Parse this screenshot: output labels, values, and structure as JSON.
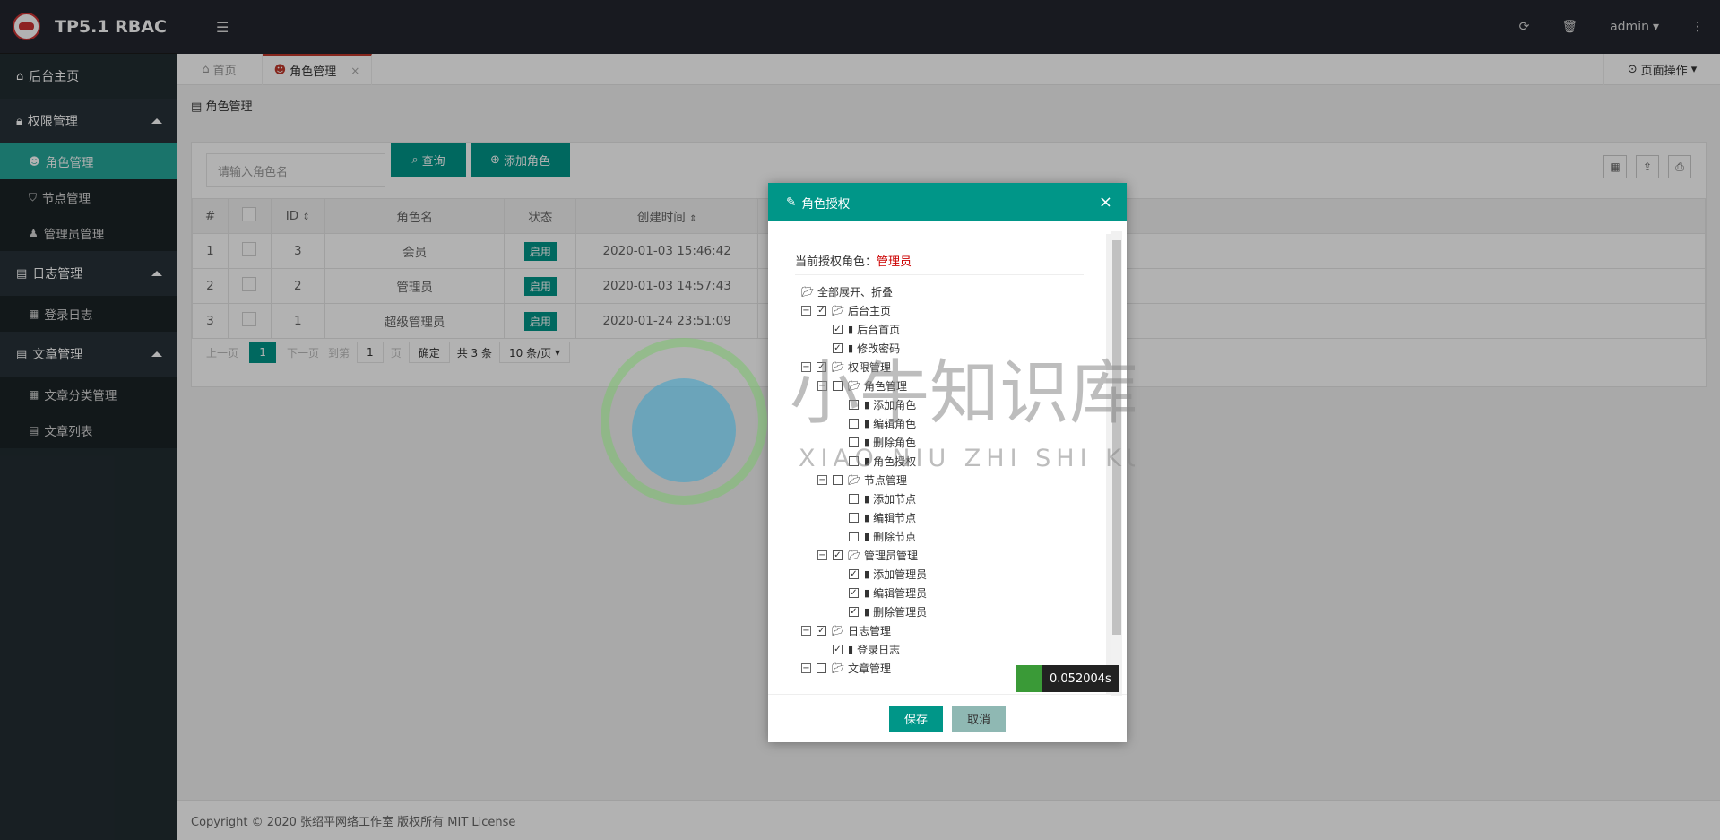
{
  "app": {
    "title": "TP5.1 RBAC"
  },
  "sidebar": {
    "home": "后台主页",
    "groups": [
      {
        "label": "权限管理",
        "items": [
          "角色管理",
          "节点管理",
          "管理员管理"
        ]
      },
      {
        "label": "日志管理",
        "items": [
          "登录日志"
        ]
      },
      {
        "label": "文章管理",
        "items": [
          "文章分类管理",
          "文章列表"
        ]
      }
    ]
  },
  "topbar": {
    "user": "admin"
  },
  "tabs": {
    "home": "首页",
    "current": "角色管理",
    "close": "×",
    "page_ops": "页面操作"
  },
  "breadcrumb": "角色管理",
  "toolbar": {
    "search_placeholder": "请输入角色名",
    "search_button": "查询",
    "add_button": "添加角色"
  },
  "table": {
    "headers": [
      "#",
      "ID",
      "角色名",
      "状态",
      "创建时间"
    ],
    "rows": [
      {
        "idx": "1",
        "id": "3",
        "name": "会员",
        "status": "启用",
        "created": "2020-01-03 15:46:42"
      },
      {
        "idx": "2",
        "id": "2",
        "name": "管理员",
        "status": "启用",
        "created": "2020-01-03 14:57:43"
      },
      {
        "idx": "3",
        "id": "1",
        "name": "超级管理员",
        "status": "启用",
        "created": "2020-01-24 23:51:09"
      }
    ]
  },
  "pager": {
    "prev": "上一页",
    "current": "1",
    "next": "下一页",
    "goto": "到第",
    "page_input": "1",
    "page_unit": "页",
    "confirm": "确定",
    "total": "共 3 条",
    "per_page": "10 条/页"
  },
  "modal": {
    "title": "角色授权",
    "current_role_label": "当前授权角色：",
    "current_role": "管理员",
    "expand_all": "全部展开、折叠",
    "save": "保存",
    "cancel": "取消"
  },
  "tree": [
    {
      "label": "后台主页",
      "level": 0,
      "checked": true,
      "folder": true
    },
    {
      "label": "后台首页",
      "level": 1,
      "checked": true,
      "folder": false
    },
    {
      "label": "修改密码",
      "level": 1,
      "checked": true,
      "folder": false
    },
    {
      "label": "权限管理",
      "level": 0,
      "checked": true,
      "folder": true
    },
    {
      "label": "角色管理",
      "level": 1,
      "checked": false,
      "folder": true
    },
    {
      "label": "添加角色",
      "level": 2,
      "checked": false,
      "folder": false
    },
    {
      "label": "编辑角色",
      "level": 2,
      "checked": false,
      "folder": false
    },
    {
      "label": "删除角色",
      "level": 2,
      "checked": false,
      "folder": false
    },
    {
      "label": "角色授权",
      "level": 2,
      "checked": false,
      "folder": false
    },
    {
      "label": "节点管理",
      "level": 1,
      "checked": false,
      "folder": true
    },
    {
      "label": "添加节点",
      "level": 2,
      "checked": false,
      "folder": false
    },
    {
      "label": "编辑节点",
      "level": 2,
      "checked": false,
      "folder": false
    },
    {
      "label": "删除节点",
      "level": 2,
      "checked": false,
      "folder": false
    },
    {
      "label": "管理员管理",
      "level": 1,
      "checked": true,
      "folder": true
    },
    {
      "label": "添加管理员",
      "level": 2,
      "checked": true,
      "folder": false
    },
    {
      "label": "编辑管理员",
      "level": 2,
      "checked": true,
      "folder": false
    },
    {
      "label": "删除管理员",
      "level": 2,
      "checked": true,
      "folder": false
    },
    {
      "label": "日志管理",
      "level": 0,
      "checked": true,
      "folder": true
    },
    {
      "label": "登录日志",
      "level": 1,
      "checked": true,
      "folder": false
    },
    {
      "label": "文章管理",
      "level": 0,
      "checked": false,
      "folder": true
    }
  ],
  "timer": "0.052004s",
  "footer": "Copyright © 2020 张绍平网络工作室 版权所有 MIT License",
  "watermark": {
    "cn": "小牛知识库",
    "en": "XIAO NIU ZHI SHI KU"
  },
  "colors": {
    "accent": "#009688",
    "sidebar": "#222d32",
    "danger": "#c00"
  }
}
